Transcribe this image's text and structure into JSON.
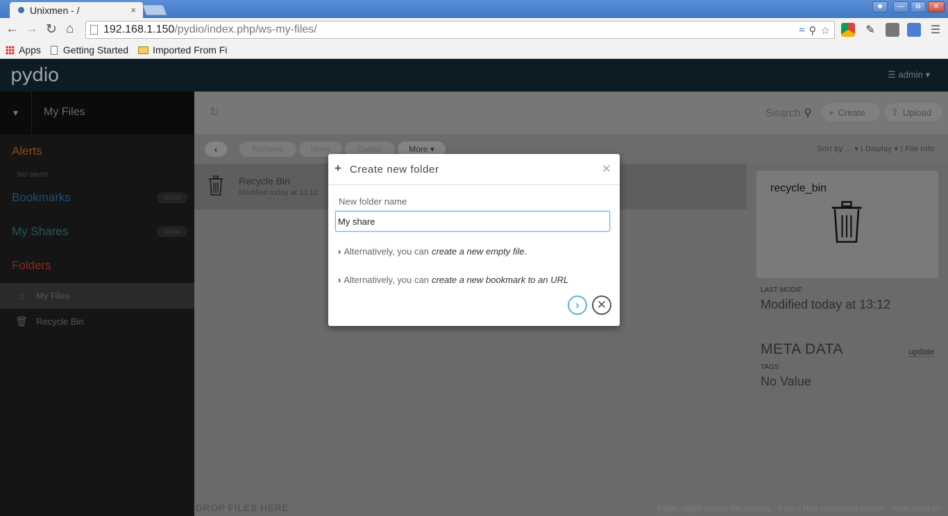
{
  "browser": {
    "tab_title": "Unixmen - /",
    "tab_close": "×",
    "url_host": "192.168.1.150",
    "url_path": "/pydio/index.php/ws-my-files/",
    "bookmarks": [
      {
        "label": "Apps",
        "icon": "apps-grid-icon"
      },
      {
        "label": "Getting Started",
        "icon": "page-icon"
      },
      {
        "label": "Imported From Fi",
        "icon": "folder-icon"
      }
    ]
  },
  "app": {
    "logo": "pydio",
    "user": "admin"
  },
  "workspace": {
    "title": "My Files"
  },
  "sidebar": {
    "alerts_title": "Alerts",
    "no_alerts": "No alerts",
    "bookmarks_title": "Bookmarks",
    "bookmarks_show": "show",
    "shares_title": "My Shares",
    "shares_show": "show",
    "folders_title": "Folders",
    "folders": [
      {
        "label": "My Files",
        "icon": "home-icon",
        "selected": true
      },
      {
        "label": "Recycle Bin",
        "icon": "trash-icon",
        "selected": false
      }
    ],
    "colors": {
      "alerts": "#8a4b1a",
      "bookmarks": "#1f4d75",
      "shares": "#1f5a57",
      "folders": "#8a2a1e"
    }
  },
  "actions": {
    "search_placeholder": "Search",
    "create": "Create",
    "upload": "Upload",
    "rename": "Rename",
    "move": "Move",
    "delete": "Delete",
    "more": "More",
    "sort_by": "Sort by ...",
    "display": "Display",
    "file_info": "File Info"
  },
  "files": [
    {
      "name": "Recycle Bin",
      "modified": "Modified today at 13:12"
    }
  ],
  "info": {
    "name": "recycle_bin",
    "last_modif_label": "LAST MODIF.",
    "last_modif_value": "Modified today at 13:12",
    "meta_title": "META DATA",
    "meta_update": "update",
    "tags_label": "TAGS",
    "tags_value": "No Value"
  },
  "footer": {
    "drop_hint": "DROP FILES HERE",
    "credits": "Pydio, open source file sharing - Free / Non supported edition - https://pyd.io/"
  },
  "dialog": {
    "title": "Create new folder",
    "field_label": "New folder name",
    "field_value": "My share",
    "alt_prefix": "Alternatively, you can",
    "alt_file_link": "create a new empty file.",
    "alt_bookmark_link": "create a new bookmark to an URL"
  }
}
